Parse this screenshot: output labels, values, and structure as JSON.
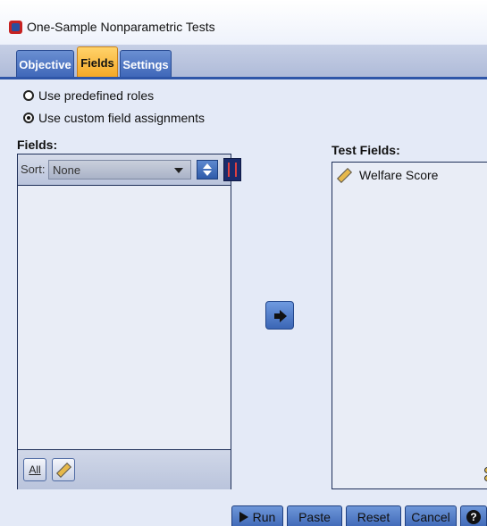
{
  "window": {
    "title": "One-Sample Nonparametric Tests"
  },
  "tabs": [
    {
      "label": "Objective",
      "active": false
    },
    {
      "label": "Fields",
      "active": true
    },
    {
      "label": "Settings",
      "active": false
    }
  ],
  "options": {
    "predefined_label": "Use predefined roles",
    "custom_label": "Use custom field assignments",
    "selected": "custom"
  },
  "fields_panel": {
    "label": "Fields:",
    "sort_label": "Sort:",
    "sort_value": "None",
    "items": [],
    "all_button": "All"
  },
  "test_fields": {
    "label": "Test Fields:",
    "items": [
      {
        "name": "Welfare Score",
        "icon": "ruler-icon"
      }
    ]
  },
  "buttons": {
    "run": "Run",
    "paste": "Paste",
    "reset": "Reset",
    "cancel": "Cancel",
    "help": "?"
  },
  "colors": {
    "accent_active_tab": "#f5a623",
    "tab_blue": "#3e66b8",
    "button_blue": "#3e67b6"
  }
}
